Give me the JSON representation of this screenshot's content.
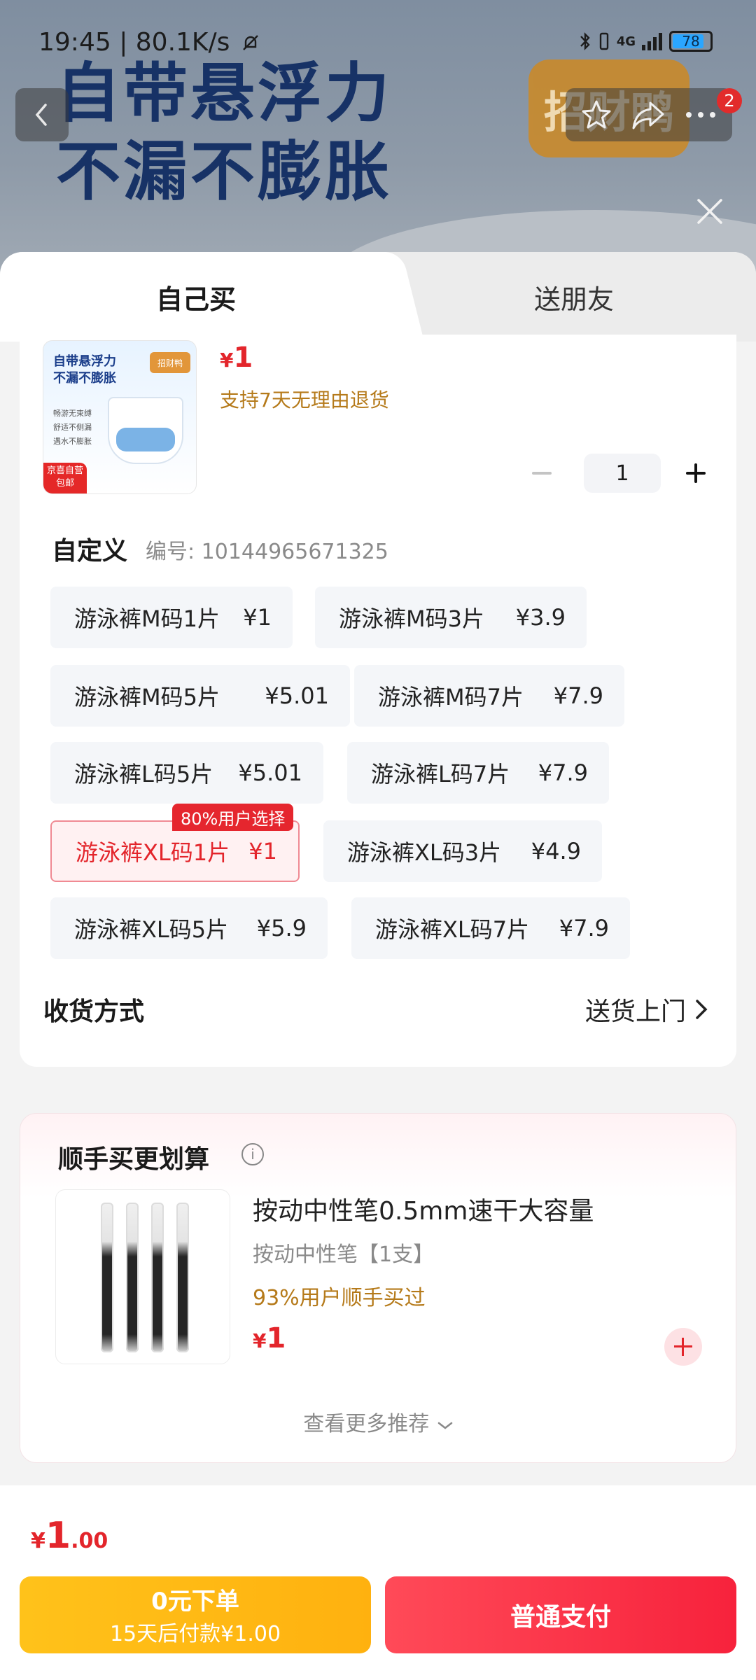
{
  "status_bar": {
    "time": "19:45 | 80.1K/s",
    "network": "4G",
    "battery": "78"
  },
  "banner": {
    "headline_line1": "自带悬浮力",
    "headline_line2": "不漏不膨胀",
    "brand_logo_text": "招财鸭",
    "notification_count": "2"
  },
  "tabs": [
    {
      "label": "自己买"
    },
    {
      "label": "送朋友"
    }
  ],
  "product": {
    "image_headline": "自带悬浮力\n不漏不膨胀",
    "image_logo": "招财鸭",
    "image_features": "畅游无束缚\n舒适不侧漏\n遇水不膨胀",
    "image_tag": "京喜自营\n包邮",
    "price_symbol": "¥",
    "price": "1",
    "return_policy": "支持7天无理由退货",
    "quantity": "1"
  },
  "spec": {
    "title": "自定义",
    "code": "编号: 10144965671325",
    "popular_tag": "80%用户选择",
    "options": [
      {
        "name": "游泳裤M码1片",
        "price": "¥1"
      },
      {
        "name": "游泳裤M码3片",
        "price": "¥3.9"
      },
      {
        "name": "游泳裤M码5片",
        "price": "¥5.01"
      },
      {
        "name": "游泳裤M码7片",
        "price": "¥7.9"
      },
      {
        "name": "游泳裤L码5片",
        "price": "¥5.01"
      },
      {
        "name": "游泳裤L码7片",
        "price": "¥7.9"
      },
      {
        "name": "游泳裤XL码1片",
        "price": "¥1"
      },
      {
        "name": "游泳裤XL码3片",
        "price": "¥4.9"
      },
      {
        "name": "游泳裤XL码5片",
        "price": "¥5.9"
      },
      {
        "name": "游泳裤XL码7片",
        "price": "¥7.9"
      }
    ],
    "selected_index": 6
  },
  "shipping": {
    "label": "收货方式",
    "value": "送货上门"
  },
  "recommend": {
    "title": "顺手买更划算",
    "item_name": "按动中性笔0.5mm速干大容量",
    "item_sub": "按动中性笔【1支】",
    "item_stat": "93%用户顺手买过",
    "price_symbol": "¥",
    "price": "1",
    "more": "查看更多推荐"
  },
  "footer": {
    "total_symbol": "¥",
    "total_int": "1",
    "total_dec": ".00",
    "pay_later_line1": "0元下单",
    "pay_later_line2": "15天后付款¥1.00",
    "pay_label": "普通支付"
  },
  "colors": {
    "accent_red": "#e3252b",
    "gold_text": "#b57a1a",
    "pay_later_yellow": "#ffb10f",
    "pay_red": "#f7223c"
  }
}
